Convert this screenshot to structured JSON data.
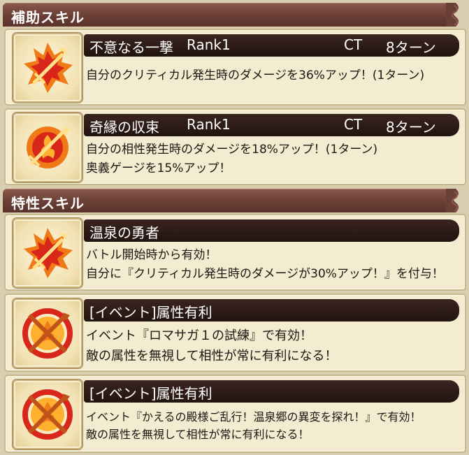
{
  "sections": {
    "support": {
      "title": "補助スキル"
    },
    "trait": {
      "title": "特性スキル"
    }
  },
  "skills": [
    {
      "name": "不意なる一撃",
      "rank": "Rank1",
      "ct_label": "CT",
      "turns": "8ターン",
      "lines": [
        "自分のクリティカル発生時のダメージを36%アップ！(1ターン)"
      ],
      "icon": "flame-sword-icon"
    },
    {
      "name": "奇縁の収束",
      "rank": "Rank1",
      "ct_label": "CT",
      "turns": "8ターン",
      "lines": [
        "自分の相性発生時のダメージを18%アップ！(1ターン)",
        "奥義ゲージを15%アップ！"
      ],
      "icon": "flame-emblem-icon"
    }
  ],
  "traits": [
    {
      "name": "温泉の勇者",
      "lines": [
        "バトル開始時から有効！",
        "自分に『クリティカル発生時のダメージが30%アップ！』を付与！"
      ],
      "icon": "flame-sword-icon"
    },
    {
      "name": "[イベント]属性有利",
      "lines": [
        "イベント『ロマサガ１の試練』で有効！",
        "敵の属性を無視して相性が常に有利になる！"
      ],
      "icon": "attribute-advantage-icon"
    },
    {
      "name": "[イベント]属性有利",
      "lines": [
        "イベント『かえるの殿様ご乱行！温泉郷の異変を探れ！』で有効！",
        "敵の属性を無視して相性が常に有利になる！"
      ],
      "icon": "attribute-advantage-icon"
    }
  ],
  "colors": {
    "header_brown": "#6a3f35",
    "card_bg": "#f3ecd0",
    "bar_dark": "#22140f",
    "flame_orange": "#f07a16",
    "flame_red": "#d8261b"
  }
}
